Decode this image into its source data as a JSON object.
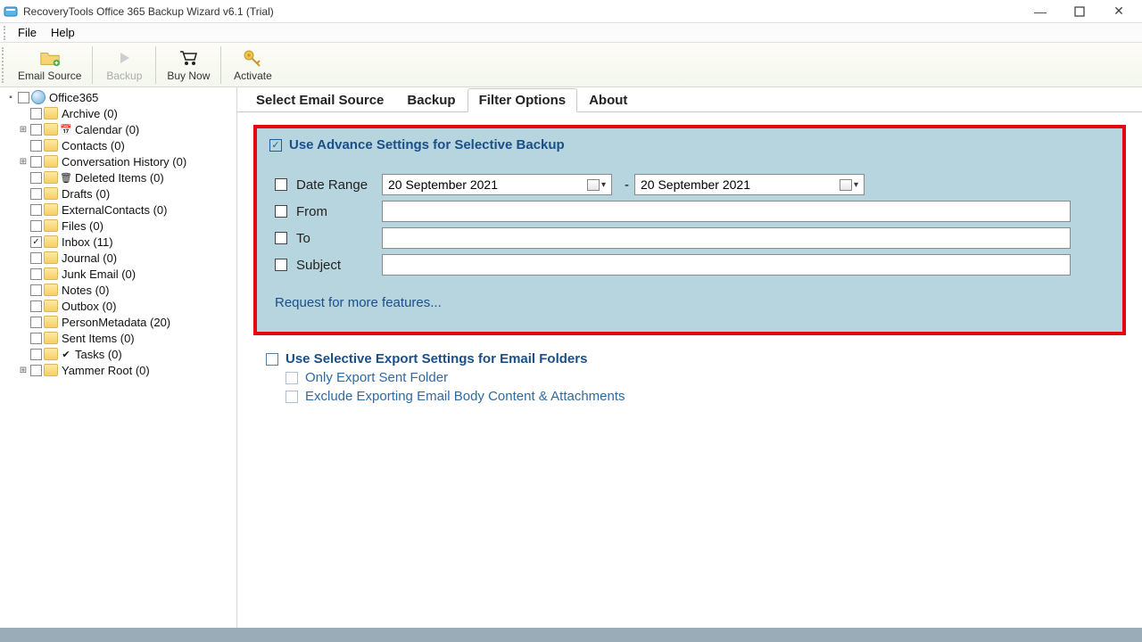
{
  "window": {
    "title": "RecoveryTools Office 365 Backup Wizard v6.1 (Trial)"
  },
  "menu": {
    "file": "File",
    "help": "Help"
  },
  "toolbar": {
    "email_source": "Email Source",
    "backup": "Backup",
    "buy_now": "Buy Now",
    "activate": "Activate"
  },
  "tree": {
    "root": "Office365",
    "items": [
      {
        "label": "Archive (0)",
        "glyph": ""
      },
      {
        "label": "Calendar (0)",
        "glyph": "📅",
        "expandable": true
      },
      {
        "label": "Contacts (0)",
        "glyph": ""
      },
      {
        "label": "Conversation History (0)",
        "glyph": "",
        "expandable": true
      },
      {
        "label": "Deleted Items (0)",
        "glyph": "🗑"
      },
      {
        "label": "Drafts (0)",
        "glyph": ""
      },
      {
        "label": "ExternalContacts (0)",
        "glyph": ""
      },
      {
        "label": "Files (0)",
        "glyph": ""
      },
      {
        "label": "Inbox (11)",
        "glyph": "",
        "checked": true
      },
      {
        "label": "Journal (0)",
        "glyph": ""
      },
      {
        "label": "Junk Email (0)",
        "glyph": ""
      },
      {
        "label": "Notes (0)",
        "glyph": ""
      },
      {
        "label": "Outbox (0)",
        "glyph": ""
      },
      {
        "label": "PersonMetadata (20)",
        "glyph": ""
      },
      {
        "label": "Sent Items (0)",
        "glyph": ""
      },
      {
        "label": "Tasks (0)",
        "glyph": "✔"
      },
      {
        "label": "Yammer Root (0)",
        "glyph": "",
        "expandable": true
      }
    ]
  },
  "tabs": {
    "select_source": "Select Email Source",
    "backup": "Backup",
    "filter_options": "Filter Options",
    "about": "About"
  },
  "filters": {
    "advance_title": "Use Advance Settings for Selective Backup",
    "date_range_label": "Date Range",
    "date_from": "20 September 2021",
    "date_to": "20 September 2021",
    "dash": "-",
    "from_label": "From",
    "to_label": "To",
    "subject_label": "Subject",
    "from_value": "",
    "to_value": "",
    "subject_value": "",
    "request_link": "Request for more features..."
  },
  "export_settings": {
    "title": "Use Selective Export Settings for Email Folders",
    "only_sent": "Only Export Sent Folder",
    "exclude_body": "Exclude Exporting Email Body Content & Attachments"
  }
}
